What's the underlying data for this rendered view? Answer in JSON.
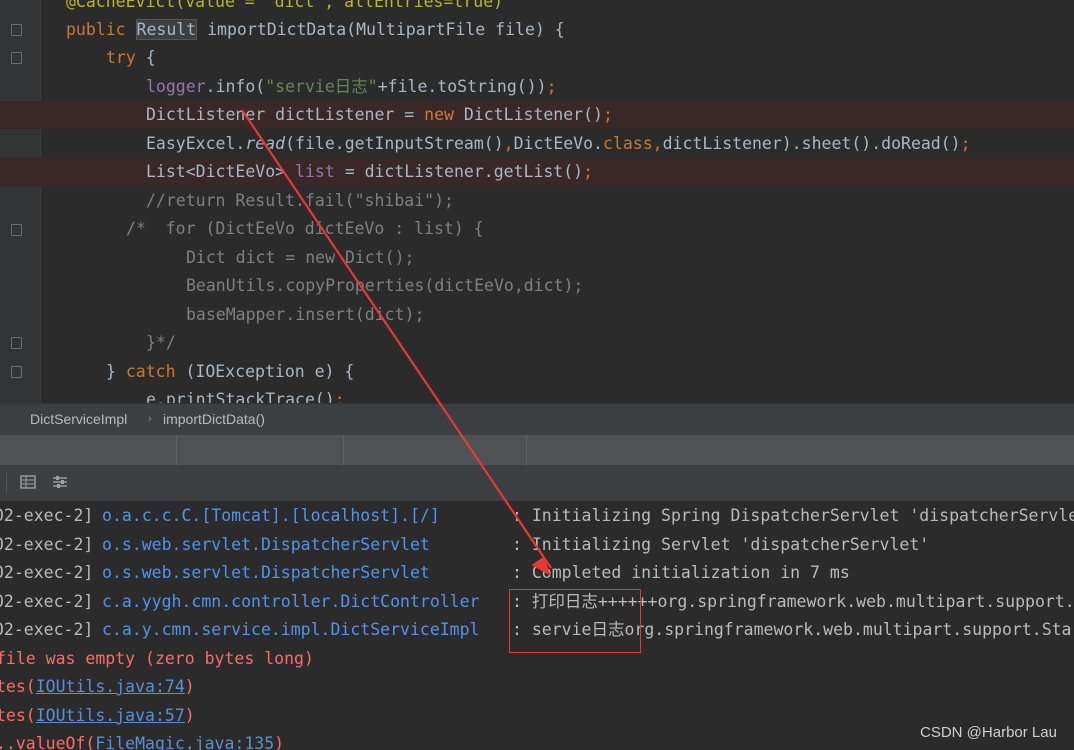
{
  "editor": {
    "lines": [
      {
        "parts": [
          {
            "t": "@CacheEvict(value = \"dict\", allEntries=true)",
            "c": "annot"
          }
        ]
      },
      {
        "parts": [
          {
            "t": "public ",
            "c": "kw"
          },
          {
            "t": "Result",
            "c": "boxed"
          },
          {
            "t": " importDictData(MultipartFile file) {",
            "c": ""
          }
        ]
      },
      {
        "parts": [
          {
            "t": "try",
            "c": "kw"
          },
          {
            "t": " {",
            "c": ""
          }
        ]
      },
      {
        "parts": [
          {
            "t": "logger",
            "c": "fld"
          },
          {
            "t": ".info(",
            "c": ""
          },
          {
            "t": "\"servie日志\"",
            "c": "str"
          },
          {
            "t": "+file.toString())",
            "c": ""
          },
          {
            "t": ";",
            "c": "kw"
          }
        ]
      },
      {
        "parts": [
          {
            "t": "DictListener dictListener = ",
            "c": ""
          },
          {
            "t": "new",
            "c": "kw"
          },
          {
            "t": " DictListener()",
            "c": ""
          },
          {
            "t": ";",
            "c": "kw"
          }
        ]
      },
      {
        "parts": [
          {
            "t": "EasyExcel.",
            "c": ""
          },
          {
            "t": "read",
            "c": "ital"
          },
          {
            "t": "(file.getInputStream()",
            "c": ""
          },
          {
            "t": ",",
            "c": "kw"
          },
          {
            "t": "DictEeVo.",
            "c": ""
          },
          {
            "t": "class",
            "c": "kw"
          },
          {
            "t": ",",
            "c": "kw"
          },
          {
            "t": "dictListener).sheet().doRead()",
            "c": ""
          },
          {
            "t": ";",
            "c": "kw"
          }
        ]
      },
      {
        "parts": [
          {
            "t": "List<DictEeVo> ",
            "c": ""
          },
          {
            "t": "list",
            "c": "fld"
          },
          {
            "t": " = dictListener.getList()",
            "c": ""
          },
          {
            "t": ";",
            "c": "kw"
          }
        ]
      },
      {
        "parts": [
          {
            "t": "//return Result.fail(\"shibai\");",
            "c": "cm"
          }
        ]
      },
      {
        "parts": [
          {
            "t": "/*  for (DictEeVo dictEeVo : list) {",
            "c": "cm"
          }
        ]
      },
      {
        "parts": [
          {
            "t": "Dict dict = new Dict();",
            "c": "cm"
          }
        ]
      },
      {
        "parts": [
          {
            "t": "BeanUtils.copyProperties(dictEeVo,dict);",
            "c": "cm"
          }
        ]
      },
      {
        "parts": [
          {
            "t": "baseMapper.insert(dict);",
            "c": "cm"
          }
        ]
      },
      {
        "parts": [
          {
            "t": "}*/",
            "c": "cm"
          }
        ]
      },
      {
        "parts": [
          {
            "t": "} ",
            "c": ""
          },
          {
            "t": "catch",
            "c": "kw"
          },
          {
            "t": " (IOException e) {",
            "c": ""
          }
        ]
      },
      {
        "parts": [
          {
            "t": "e.printStackTrace()",
            "c": ""
          },
          {
            "t": ";",
            "c": "kw"
          }
        ]
      }
    ]
  },
  "breadcrumb": {
    "class_name": "DictServiceImpl",
    "method_name": "importDictData()"
  },
  "console": {
    "rows": [
      {
        "thread": "02-exec-2]",
        "logger": "o.a.c.c.C.[Tomcat].[localhost].[/]",
        "msg": ": Initializing Spring DispatcherServlet 'dispatcherServlet'"
      },
      {
        "thread": "02-exec-2]",
        "logger": "o.s.web.servlet.DispatcherServlet",
        "msg": ": Initializing Servlet 'dispatcherServlet'"
      },
      {
        "thread": "02-exec-2]",
        "logger": "o.s.web.servlet.DispatcherServlet",
        "msg": ": Completed initialization in 7 ms"
      },
      {
        "thread": "02-exec-2]",
        "logger": "c.a.yygh.cmn.controller.DictController",
        "msg": ": 打印日志++++++org.springframework.web.multipart.support.St"
      },
      {
        "thread": "02-exec-2]",
        "logger": "c.a.y.cmn.service.impl.DictServiceImpl",
        "msg": ": servie日志org.springframework.web.multipart.support.Sta"
      }
    ],
    "error_line": "file was empty (zero bytes long)",
    "stack": [
      {
        "prefix": "tes(",
        "link": "IOUtils.java:74",
        "suffix": ")"
      },
      {
        "prefix": "tes(",
        "link": "IOUtils.java:57",
        "suffix": ")"
      },
      {
        "prefix": "..valueOf(",
        "link": "FileMagic.java:135",
        "suffix": ")"
      }
    ]
  },
  "watermark": "CSDN @Harbor Lau",
  "colors": {
    "annotation_red": "#e53935"
  }
}
